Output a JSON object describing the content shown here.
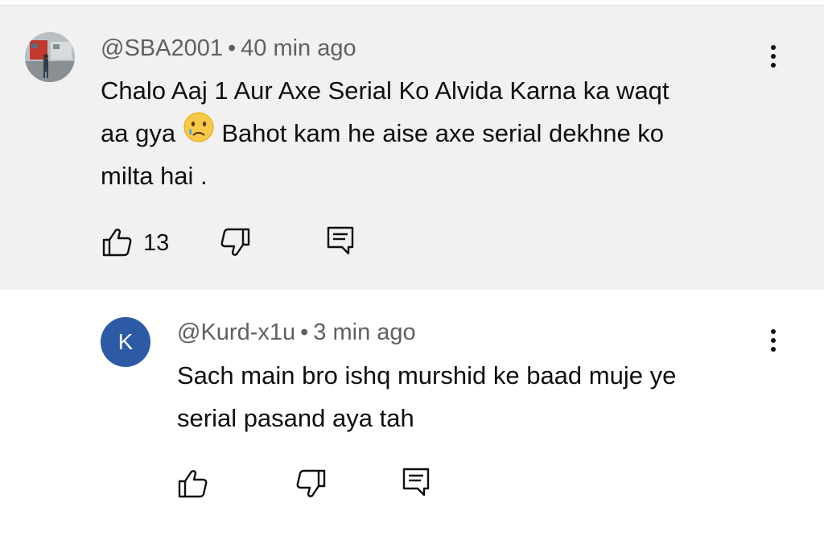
{
  "comments": [
    {
      "author": "@SBA2001",
      "separator": "•",
      "time": "40 min ago",
      "text_line1": "Chalo Aaj 1 Aur Axe Serial Ko Alvida Karna ka waqt",
      "text_line2_a": "aa gya ",
      "emoji": "crying-face",
      "text_line2_b": " Bahot kam he aise axe serial dekhne ko",
      "text_line3": "milta hai .",
      "like_count": "13",
      "avatar": "photo"
    },
    {
      "author": "@Kurd-x1u",
      "separator": "•",
      "time": "3 min ago",
      "text_line1": "Sach main bro ishq murshid ke baad muje ye",
      "text_line2": "serial pasand aya tah",
      "avatar_letter": "K",
      "avatar_color": "#2c5aa5"
    }
  ],
  "icons": [
    "thumbs-up-icon",
    "thumbs-down-icon",
    "reply-icon",
    "more-vert-icon"
  ],
  "colors": {
    "highlight_bg": "#f1f1f1",
    "meta_text": "#606060",
    "text": "#0f0f0f"
  }
}
